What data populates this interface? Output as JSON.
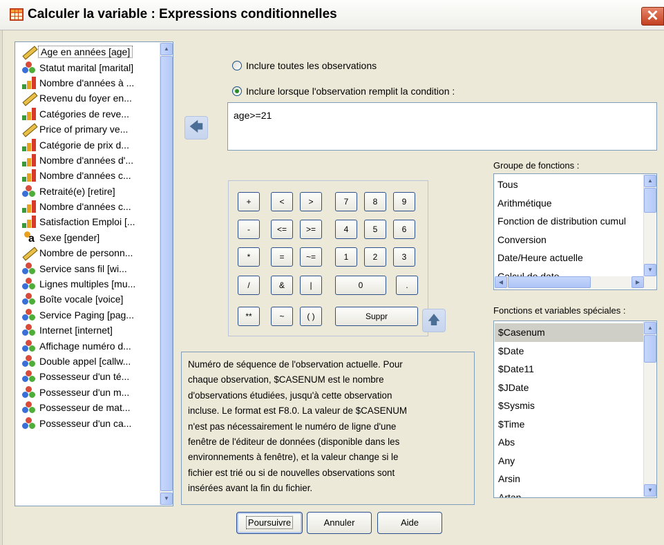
{
  "window": {
    "title": "Calculer la variable : Expressions conditionnelles",
    "close": "✕"
  },
  "variables": [
    {
      "label": "Age en années [age]",
      "icon": "scale-ruler-icon",
      "type": "scale"
    },
    {
      "label": "Statut marital [marital]",
      "icon": "nominal-circles-icon",
      "type": "nominal"
    },
    {
      "label": "Nombre d'années à ...",
      "icon": "ordinal-bars-icon",
      "type": "ordinal"
    },
    {
      "label": "Revenu du foyer en...",
      "icon": "scale-ruler-icon",
      "type": "scale"
    },
    {
      "label": "Catégories de reve...",
      "icon": "ordinal-bars-icon",
      "type": "ordinal"
    },
    {
      "label": "Price of primary ve...",
      "icon": "scale-ruler-icon",
      "type": "scale"
    },
    {
      "label": "Catégorie de prix d...",
      "icon": "ordinal-bars-icon",
      "type": "ordinal"
    },
    {
      "label": "Nombre d'années d'...",
      "icon": "ordinal-bars-icon",
      "type": "ordinal"
    },
    {
      "label": "Nombre d'années c...",
      "icon": "ordinal-bars-icon",
      "type": "ordinal"
    },
    {
      "label": "Retraité(e) [retire]",
      "icon": "nominal-circles-icon",
      "type": "nominal"
    },
    {
      "label": "Nombre d'années c...",
      "icon": "ordinal-bars-icon",
      "type": "ordinal"
    },
    {
      "label": "Satisfaction Emploi [...",
      "icon": "ordinal-bars-icon",
      "type": "ordinal"
    },
    {
      "label": "Sexe [gender]",
      "icon": "string-nominal-icon",
      "type": "string"
    },
    {
      "label": "Nombre de personn...",
      "icon": "scale-ruler-icon",
      "type": "scale"
    },
    {
      "label": "Service sans fil [wi...",
      "icon": "nominal-circles-icon",
      "type": "nominal"
    },
    {
      "label": "Lignes multiples [mu...",
      "icon": "nominal-circles-icon",
      "type": "nominal"
    },
    {
      "label": "Boîte vocale [voice]",
      "icon": "nominal-circles-icon",
      "type": "nominal"
    },
    {
      "label": "Service Paging [pag...",
      "icon": "nominal-circles-icon",
      "type": "nominal"
    },
    {
      "label": "Internet [internet]",
      "icon": "nominal-circles-icon",
      "type": "nominal"
    },
    {
      "label": "Affichage numéro d...",
      "icon": "nominal-circles-icon",
      "type": "nominal"
    },
    {
      "label": "Double appel [callw...",
      "icon": "nominal-circles-icon",
      "type": "nominal"
    },
    {
      "label": "Possesseur  d'un té...",
      "icon": "nominal-circles-icon",
      "type": "nominal"
    },
    {
      "label": "Possesseur d'un m...",
      "icon": "nominal-circles-icon",
      "type": "nominal"
    },
    {
      "label": "Possesseur de mat...",
      "icon": "nominal-circles-icon",
      "type": "nominal"
    },
    {
      "label": "Possesseur d'un ca...",
      "icon": "nominal-circles-icon",
      "type": "nominal"
    }
  ],
  "radio_all": {
    "label": "Inclure toutes les observations",
    "checked": false
  },
  "radio_cond": {
    "label": "Inclure lorsque l'observation remplit la condition :",
    "checked": true
  },
  "condition": {
    "value": "age>=21"
  },
  "transfer_arrow": "🡄",
  "insert_arrow": "🡅",
  "keypad": {
    "plus": "+",
    "lt": "<",
    "gt": ">",
    "k7": "7",
    "k8": "8",
    "k9": "9",
    "minus": "-",
    "le": "<=",
    "ge": ">=",
    "k4": "4",
    "k5": "5",
    "k6": "6",
    "mul": "*",
    "eq": "=",
    "ne": "~=",
    "k1": "1",
    "k2": "2",
    "k3": "3",
    "div": "/",
    "and": "&",
    "or": "|",
    "k0": "0",
    "dot": ".",
    "pow": "**",
    "not": "~",
    "paren": "( )",
    "delete": "Suppr"
  },
  "function_group": {
    "label": "Groupe de fonctions :",
    "items": [
      "Tous",
      "Arithmétique",
      "Fonction de distribution cumul",
      "Conversion",
      "Date/Heure actuelle",
      "Calcul de date"
    ]
  },
  "special_functions": {
    "label": "Fonctions et variables spéciales :",
    "items": [
      "$Casenum",
      "$Date",
      "$Date11",
      "$JDate",
      "$Sysmis",
      "$Time",
      "Abs",
      "Any",
      "Arsin",
      "Artan"
    ],
    "selected": "$Casenum"
  },
  "description": {
    "lines": [
      "Numéro de séquence de l'observation actuelle. Pour",
      "chaque observation, $CASENUM est le nombre",
      "d'observations étudiées, jusqu'à cette observation",
      "incluse. Le format est F8.0. La valeur de $CASENUM",
      "n'est pas nécessairement le numéro de ligne d'une",
      "fenêtre de l'éditeur de données (disponible dans les",
      "environnements à fenêtre), et la valeur change si le",
      "fichier est trié ou si de nouvelles observations sont",
      "insérées avant la fin du fichier."
    ]
  },
  "buttons": {
    "continue": "Poursuivre",
    "cancel": "Annuler",
    "help": "Aide"
  },
  "colors": {
    "dialog_bg": "#ece9d8",
    "border": "#7f9db9",
    "button_border": "#2a4f8a",
    "selection": "#cfcfc8"
  }
}
